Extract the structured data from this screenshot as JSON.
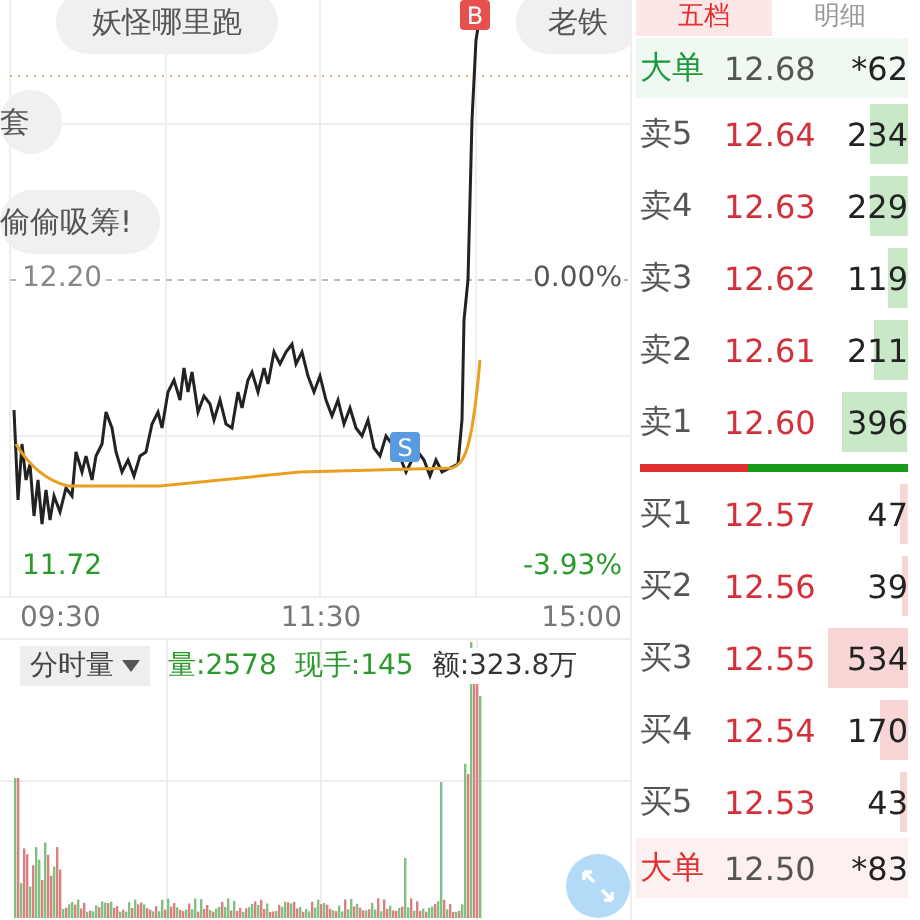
{
  "danmaku": [
    {
      "text": "妖怪哪里跑"
    },
    {
      "text": "老铁"
    },
    {
      "text": "套"
    },
    {
      "text": "偷偷吸筹!"
    }
  ],
  "chart": {
    "ref_price": "12.20",
    "ref_pct": "0.00%",
    "low_price": "11.72",
    "low_pct": "-3.93%",
    "times": [
      "09:30",
      "11:30",
      "15:00"
    ],
    "markers": [
      {
        "kind": "buy",
        "label": "B"
      },
      {
        "kind": "sell",
        "label": "S"
      }
    ]
  },
  "volume": {
    "selector": "分时量",
    "volume": "量:2578",
    "hand": "现手:145",
    "amount": "额:323.8万"
  },
  "tabs": [
    {
      "label": "五档",
      "selected": true
    },
    {
      "label": "明细",
      "selected": false
    }
  ],
  "order_book": {
    "rows": [
      {
        "kind": "big",
        "label": "大单",
        "price": "12.68",
        "qty": "*62",
        "color": "#1a9a3a"
      },
      {
        "kind": "ask",
        "label": "卖5",
        "price": "12.64",
        "qty": "234"
      },
      {
        "kind": "ask",
        "label": "卖4",
        "price": "12.63",
        "qty": "229"
      },
      {
        "kind": "ask",
        "label": "卖3",
        "price": "12.62",
        "qty": "119"
      },
      {
        "kind": "ask",
        "label": "卖2",
        "price": "12.61",
        "qty": "211"
      },
      {
        "kind": "ask",
        "label": "卖1",
        "price": "12.60",
        "qty": "396"
      },
      {
        "kind": "balance",
        "level": 0.4
      },
      {
        "kind": "bid",
        "label": "买1",
        "price": "12.57",
        "qty": "47"
      },
      {
        "kind": "bid",
        "label": "买2",
        "price": "12.56",
        "qty": "39"
      },
      {
        "kind": "bid",
        "label": "买3",
        "price": "12.55",
        "qty": "534"
      },
      {
        "kind": "bid",
        "label": "买4",
        "price": "12.54",
        "qty": "170"
      },
      {
        "kind": "bid",
        "label": "买5",
        "price": "12.53",
        "qty": "43"
      },
      {
        "kind": "big",
        "label": "大单",
        "price": "12.50",
        "qty": "*83",
        "color": "#e03030"
      }
    ]
  }
}
